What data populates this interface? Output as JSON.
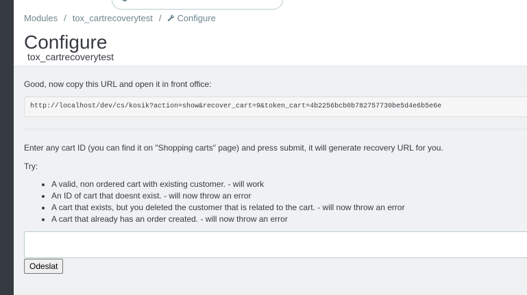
{
  "breadcrumb": {
    "items": [
      "Modules",
      "tox_cartrecoverytest"
    ],
    "current": "Configure",
    "separator": "/",
    "current_icon": "wrench-icon"
  },
  "header": {
    "title": "Configure",
    "subtitle": "tox_cartrecoverytest"
  },
  "main": {
    "copy_label": "Good, now copy this URL and open it in front office:",
    "url": "http://localhost/dev/cs/kosik?action=show&recover_cart=9&token_cart=4b2256bcb0b782757730be5d4e6b5e6e",
    "instructions": "Enter any cart ID (you can find it on \"Shopping carts\" page) and press submit, it will generate recovery URL for you.",
    "try_label": "Try:",
    "try_items": [
      "A valid, non ordered cart with existing customer. - will work",
      "An ID of cart that doesnt exist. - will now throw an error",
      "A cart that exists, but you deleted the customer that is related to the cart. - will now throw an error",
      "A cart that already has an order created. - will now throw an error"
    ],
    "cart_input": {
      "value": "",
      "placeholder": ""
    },
    "submit_label": "Odeslat"
  },
  "colors": {
    "sidebar": "#363a41",
    "background": "#eff1f2",
    "text": "#363a41",
    "muted": "#6c868e"
  }
}
